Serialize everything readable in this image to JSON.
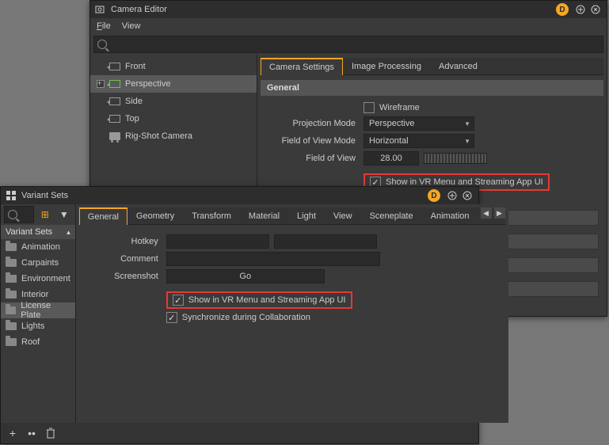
{
  "camera_editor": {
    "title": "Camera Editor",
    "menu": {
      "file": "File",
      "view": "View"
    },
    "tree": {
      "items": [
        {
          "label": "Front",
          "type": "cam"
        },
        {
          "label": "Perspective",
          "type": "persp",
          "selected": true,
          "expandable": true
        },
        {
          "label": "Side",
          "type": "cam"
        },
        {
          "label": "Top",
          "type": "cam"
        },
        {
          "label": "Rig-Shot Camera",
          "type": "rig"
        }
      ]
    },
    "tabs": {
      "t0": "Camera Settings",
      "t1": "Image Processing",
      "t2": "Advanced"
    },
    "section": "General",
    "wireframe": "Wireframe",
    "proj_mode_label": "Projection Mode",
    "proj_mode_value": "Perspective",
    "fov_mode_label": "Field of View Mode",
    "fov_mode_value": "Horizontal",
    "fov_label": "Field of View",
    "fov_value": "28.00",
    "show_vr": "Show in VR Menu and Streaming App UI"
  },
  "variant_sets": {
    "title": "Variant Sets",
    "header": "Variant Sets",
    "items": [
      "Animation",
      "Carpaints",
      "Environment",
      "Interior",
      "License Plate",
      "Lights",
      "Roof"
    ],
    "selected_index": 4,
    "tabs": {
      "t0": "General",
      "t1": "Geometry",
      "t2": "Transform",
      "t3": "Material",
      "t4": "Light",
      "t5": "View",
      "t6": "Sceneplate",
      "t7": "Animation"
    },
    "hotkey_label": "Hotkey",
    "comment_label": "Comment",
    "screenshot_label": "Screenshot",
    "go": "Go",
    "show_vr": "Show in VR Menu and Streaming App UI",
    "sync": "Synchronize during Collaboration"
  }
}
